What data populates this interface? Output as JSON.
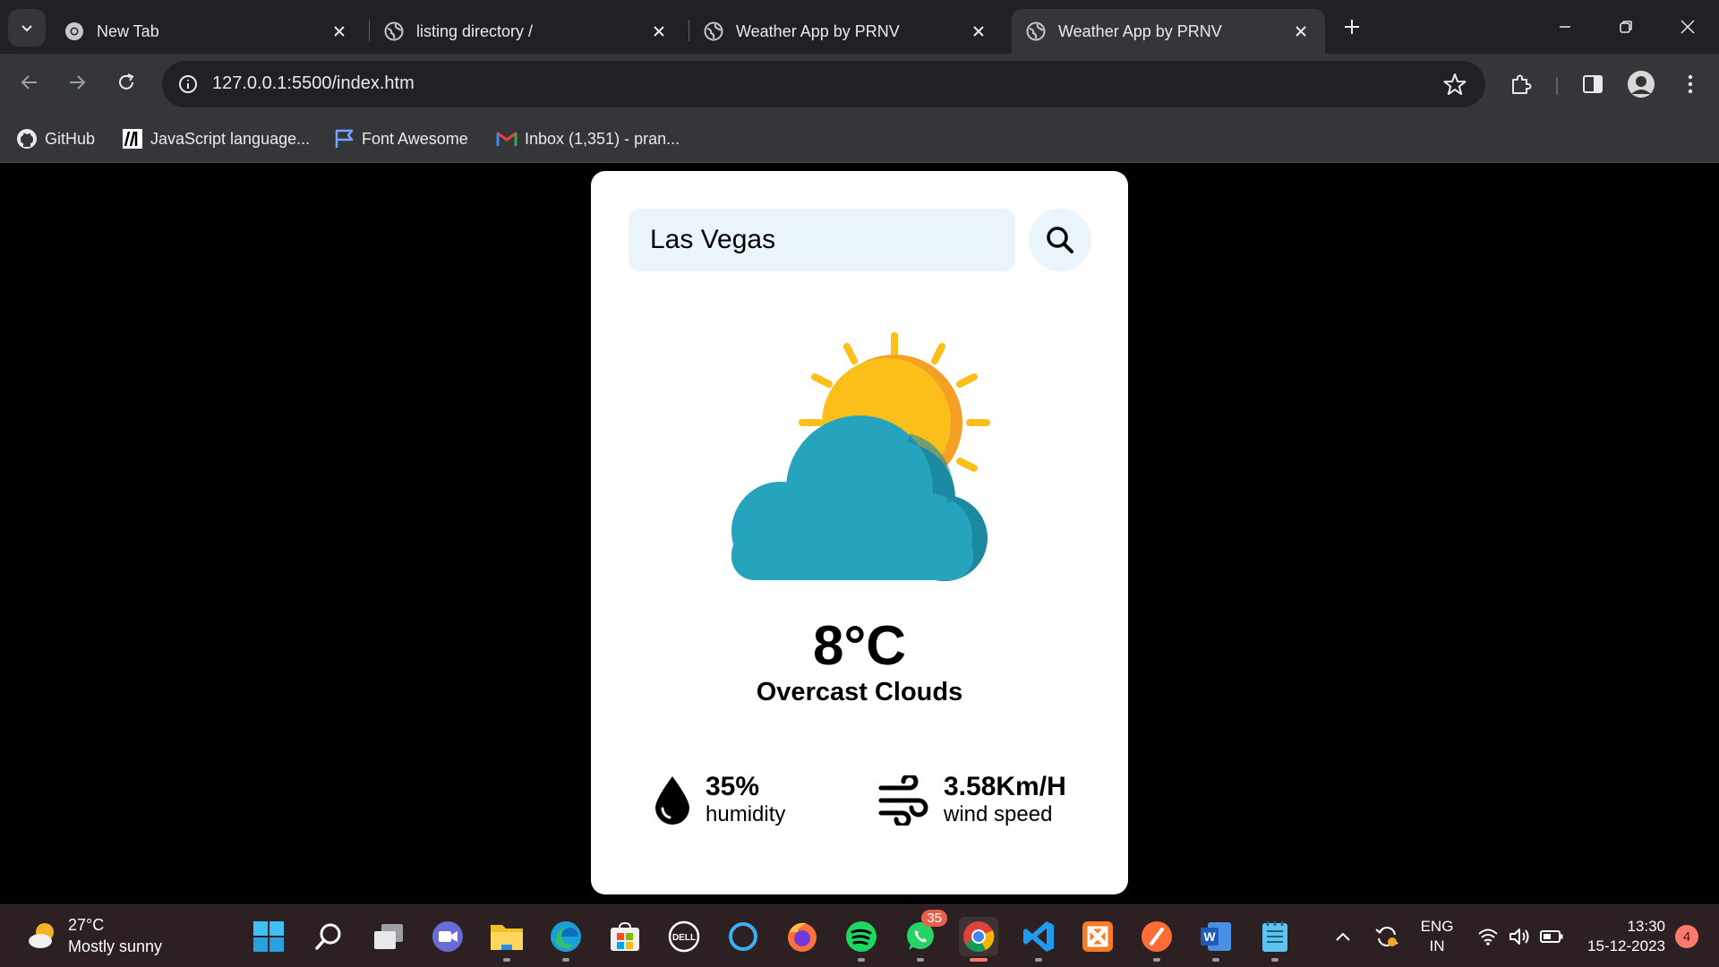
{
  "browser": {
    "tabs": [
      {
        "title": "New Tab",
        "icon": "chrome-icon",
        "active": false
      },
      {
        "title": "listing directory /",
        "icon": "globe-icon",
        "active": false
      },
      {
        "title": "Weather App by PRNV",
        "icon": "globe-icon",
        "active": false
      },
      {
        "title": "Weather App by PRNV",
        "icon": "globe-icon",
        "active": true
      }
    ],
    "url": "127.0.0.1:5500/index.htm",
    "bookmarks": [
      {
        "label": "GitHub",
        "icon": "github-icon"
      },
      {
        "label": "JavaScript language...",
        "icon": "mdn-icon"
      },
      {
        "label": "Font Awesome",
        "icon": "flag-icon"
      },
      {
        "label": "Inbox (1,351) - pran...",
        "icon": "gmail-icon"
      }
    ]
  },
  "weather_app": {
    "city_value": "Las Vegas",
    "temperature": "8°C",
    "condition": "Overcast Clouds",
    "humidity_value": "35%",
    "humidity_label": "humidity",
    "wind_value": "3.58Km/H",
    "wind_label": "wind speed",
    "icon": "sun-behind-cloud-icon"
  },
  "taskbar": {
    "weather_temp": "27°C",
    "weather_desc": "Mostly sunny",
    "whatsapp_badge": "35",
    "language": "ENG",
    "region": "IN",
    "time": "13:30",
    "date": "15-12-2023",
    "notification_count": "4"
  },
  "colors": {
    "tab_strip": "#202124",
    "toolbar": "#35363a",
    "card_bg": "#ffffff",
    "input_bg": "#e9f5fb",
    "cloud": "#26a3bd",
    "sun": "#fbbf19",
    "taskbar": "#2c2022"
  }
}
